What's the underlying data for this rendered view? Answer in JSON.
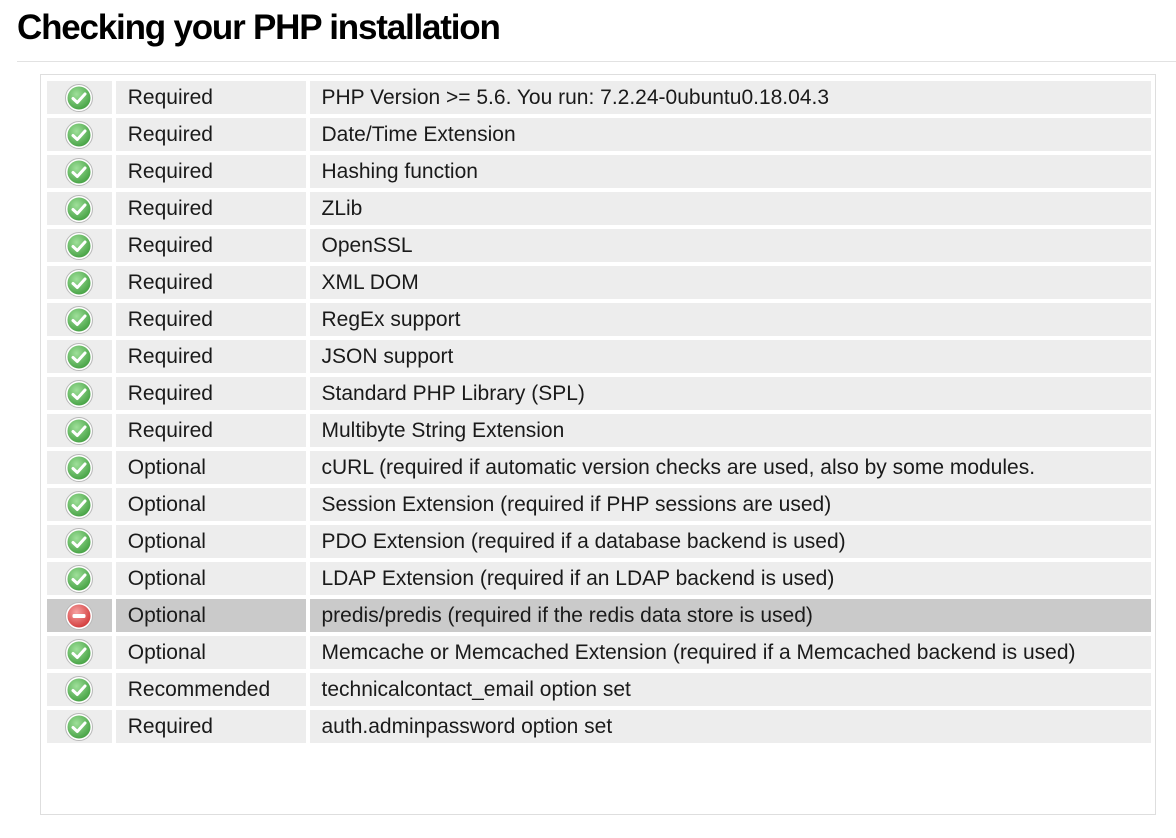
{
  "page": {
    "title": "Checking your PHP installation"
  },
  "colors": {
    "ok": "#5cb85c",
    "fail": "#e05050",
    "row_bg": "#ededed",
    "fail_row_bg": "#cacaca"
  },
  "icons": {
    "ok": "check-circle-icon",
    "fail": "no-entry-icon"
  },
  "checks": [
    {
      "status": "ok",
      "level": "Required",
      "description": "PHP Version >= 5.6. You run: 7.2.24-0ubuntu0.18.04.3"
    },
    {
      "status": "ok",
      "level": "Required",
      "description": "Date/Time Extension"
    },
    {
      "status": "ok",
      "level": "Required",
      "description": "Hashing function"
    },
    {
      "status": "ok",
      "level": "Required",
      "description": "ZLib"
    },
    {
      "status": "ok",
      "level": "Required",
      "description": "OpenSSL"
    },
    {
      "status": "ok",
      "level": "Required",
      "description": "XML DOM"
    },
    {
      "status": "ok",
      "level": "Required",
      "description": "RegEx support"
    },
    {
      "status": "ok",
      "level": "Required",
      "description": "JSON support"
    },
    {
      "status": "ok",
      "level": "Required",
      "description": "Standard PHP Library (SPL)"
    },
    {
      "status": "ok",
      "level": "Required",
      "description": "Multibyte String Extension"
    },
    {
      "status": "ok",
      "level": "Optional",
      "description": "cURL (required if automatic version checks are used, also by some modules."
    },
    {
      "status": "ok",
      "level": "Optional",
      "description": "Session Extension (required if PHP sessions are used)"
    },
    {
      "status": "ok",
      "level": "Optional",
      "description": "PDO Extension (required if a database backend is used)"
    },
    {
      "status": "ok",
      "level": "Optional",
      "description": "LDAP Extension (required if an LDAP backend is used)"
    },
    {
      "status": "fail",
      "level": "Optional",
      "description": "predis/predis (required if the redis data store is used)"
    },
    {
      "status": "ok",
      "level": "Optional",
      "description": "Memcache or Memcached Extension (required if a Memcached backend is used)"
    },
    {
      "status": "ok",
      "level": "Recommended",
      "description": "technicalcontact_email option set"
    },
    {
      "status": "ok",
      "level": "Required",
      "description": "auth.adminpassword option set"
    }
  ]
}
